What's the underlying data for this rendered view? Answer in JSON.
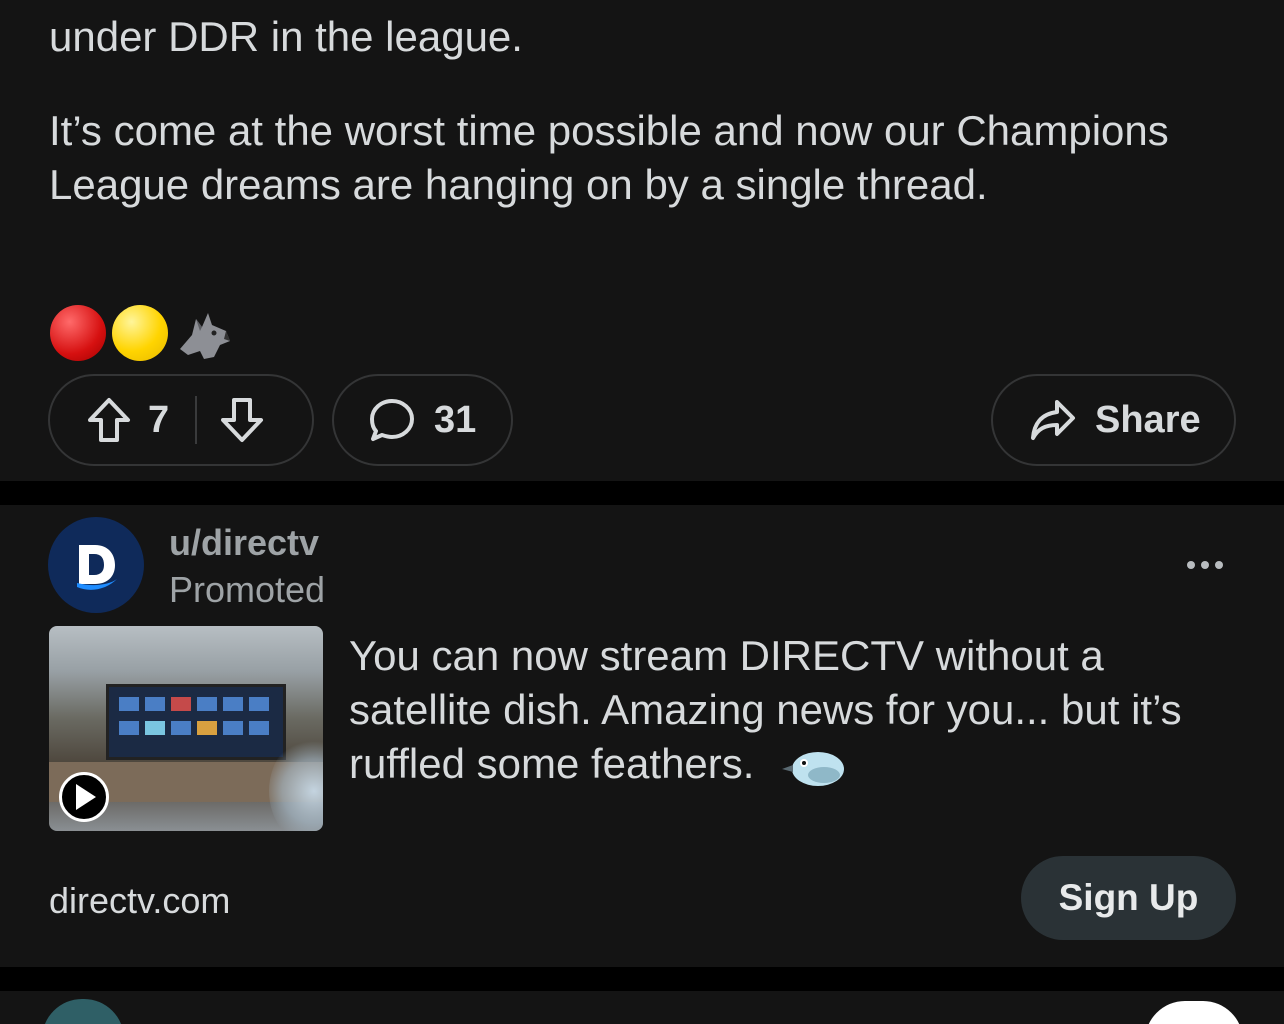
{
  "post1": {
    "cut_line": "...",
    "paragraph1": "under DDR in the league.",
    "paragraph2": "It’s come at the worst time possible and now our Champions League dreams are hanging on by a single thread.",
    "emojis": [
      "red-circle",
      "yellow-circle",
      "wolf"
    ],
    "vote_count": "7",
    "comment_count": "31",
    "share_label": "Share"
  },
  "ad": {
    "username": "u/directv",
    "promoted_label": "Promoted",
    "avatar_letter": "D",
    "text": "You can now stream DIRECTV without a satellite dish. Amazing news for you... but it’s ruffled some feathers.",
    "domain": "directv.com",
    "cta_label": "Sign Up"
  },
  "colors": {
    "background": "#000000",
    "card": "#141414",
    "text": "#d7dadc",
    "muted": "#9ea3a6",
    "pill_border": "#343536",
    "cta_bg": "#2a3236",
    "avatar_bg": "#0f2a5a"
  }
}
